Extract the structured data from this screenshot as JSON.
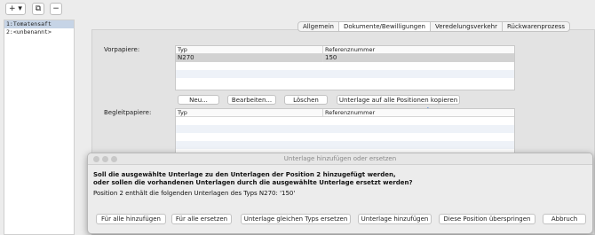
{
  "toolbar": {
    "add_label": "+ ▾",
    "copy_label": "⧉",
    "remove_label": "−"
  },
  "sidebar": {
    "items": [
      {
        "label": "1:Tomatensaft"
      },
      {
        "label": "2:<unbenannt>"
      }
    ]
  },
  "tabs": [
    {
      "label": "Allgemein"
    },
    {
      "label": "Dokumente/Bewilligungen"
    },
    {
      "label": "Veredelungsverkehr"
    },
    {
      "label": "Rückwarenprozess"
    }
  ],
  "vorpapiere": {
    "label": "Vorpapiere:",
    "columns": [
      "Typ",
      "Referenznummer"
    ],
    "rows": [
      {
        "typ": "N270",
        "ref": "150"
      }
    ]
  },
  "buttons": {
    "neu": "Neu...",
    "bearbeiten": "Bearbeiten...",
    "loeschen": "Löschen",
    "kopieren": "Unterlage auf alle Positionen kopieren"
  },
  "begleitpapiere": {
    "label": "Begleitpapiere:",
    "columns": [
      "Typ",
      "Referenznummer"
    ]
  },
  "dialog": {
    "title": "Unterlage hinzufügen oder ersetzen",
    "question_line1": "Soll die ausgewählte Unterlage zu den Unterlagen der Position 2 hinzugefügt werden,",
    "question_line2": "oder sollen die vorhandenen Unterlagen durch die ausgewählte Unterlage ersetzt werden?",
    "info": "Position 2 enthält die folgenden Unterlagen des Typs N270: '150'",
    "buttons": {
      "fuer_alle_hinzufuegen": "Für alle hinzufügen",
      "fuer_alle_ersetzen": "Für alle ersetzen",
      "gleichen_typs_ersetzen": "Unterlage gleichen Typs ersetzen",
      "hinzufuegen": "Unterlage hinzufügen",
      "ueberspringen": "Diese Position überspringen",
      "abbruch": "Abbruch"
    }
  },
  "colors": {
    "arrow": "#4a7fd8",
    "selected_row": "#d2d2d2",
    "sidebar_selected": "#c6d4e6"
  }
}
